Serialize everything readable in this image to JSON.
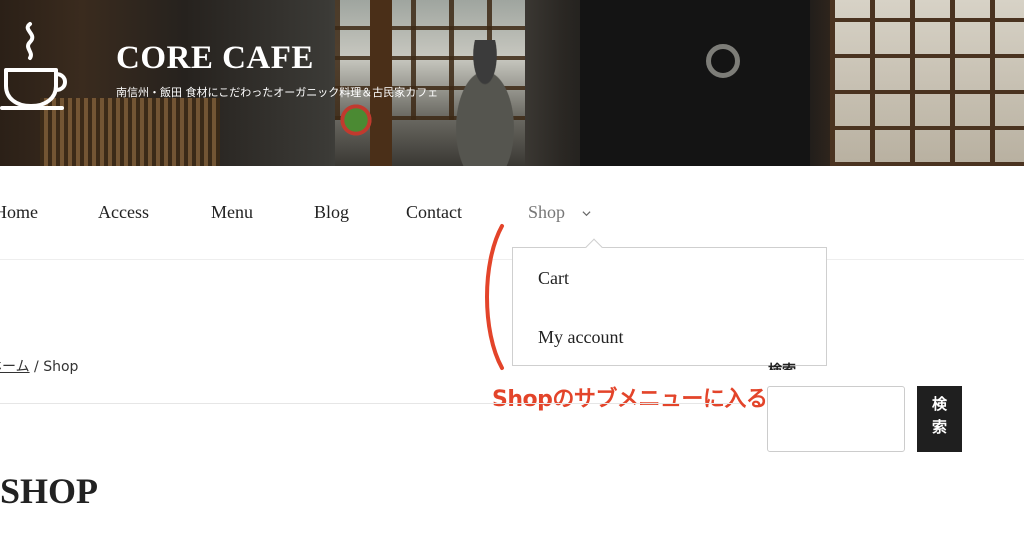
{
  "site": {
    "title": "CORE CAFE",
    "description": "南信州・飯田 食材にこだわったオーガニック料理＆古民家カフェ",
    "logo_icon": "coffee-cup-icon"
  },
  "nav": {
    "items": [
      {
        "label": "Home"
      },
      {
        "label": "Access"
      },
      {
        "label": "Menu"
      },
      {
        "label": "Blog"
      },
      {
        "label": "Contact"
      },
      {
        "label": "Shop"
      }
    ],
    "active": "Shop",
    "submenu": [
      {
        "label": "Cart"
      },
      {
        "label": "My account"
      }
    ]
  },
  "annotation": {
    "text": "Shopのサブメニューに入る",
    "color": "#e3442a"
  },
  "breadcrumb": {
    "home": "ホーム",
    "separator": " / ",
    "current": "Shop"
  },
  "page": {
    "title": "SHOP"
  },
  "search": {
    "label": "検索",
    "button": "検索",
    "placeholder": ""
  }
}
